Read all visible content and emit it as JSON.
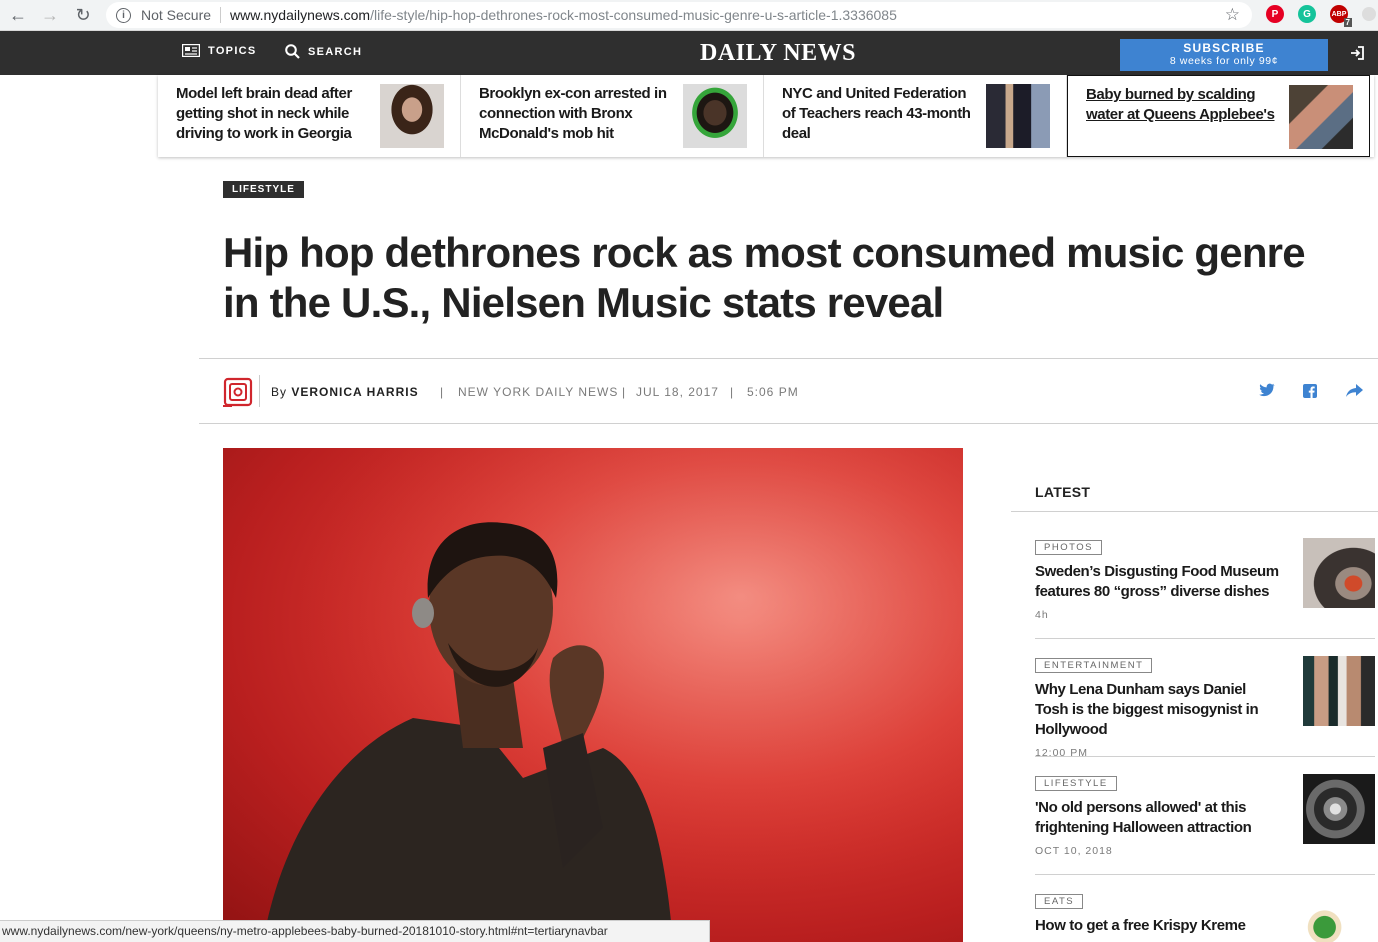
{
  "browser": {
    "security_label": "Not Secure",
    "url_host": "www.nydailynews.com",
    "url_path": "/life-style/hip-hop-dethrones-rock-most-consumed-music-genre-u-s-article-1.3336085",
    "status_url": "www.nydailynews.com/new-york/queens/ny-metro-applebees-baby-burned-20181010-story.html#nt=tertiarynavbar",
    "extensions": [
      {
        "name": "pinterest-icon",
        "color": "#e60023"
      },
      {
        "name": "grammarly-icon",
        "color": "#15c39a"
      },
      {
        "name": "adblock-icon",
        "color": "#c00000",
        "badge": "7"
      }
    ]
  },
  "header": {
    "topics_label": "TOPICS",
    "search_label": "SEARCH",
    "logo_text": "DAILY NEWS",
    "subscribe_label": "SUBSCRIBE",
    "subscribe_offer": "8 weeks for only 99¢"
  },
  "trending": [
    {
      "text": "Model left brain dead after getting shot in neck while driving to work in Georgia"
    },
    {
      "text": "Brooklyn ex-con arrested in connection with Bronx McDonald's mob hit"
    },
    {
      "text": "NYC and United Federation of Teachers reach 43-month deal"
    },
    {
      "text": "Baby burned by scalding water at Queens Applebee's"
    }
  ],
  "article": {
    "section": "LIFESTYLE",
    "headline": "Hip hop dethrones rock as most consumed music genre in the U.S., Nielsen Music stats reveal",
    "byline_prefix": "By",
    "author": "VERONICA HARRIS",
    "sep": "|",
    "publication": "NEW YORK DAILY NEWS",
    "date": "JUL 18, 2017",
    "time": "5:06 PM"
  },
  "sidebar": {
    "title": "LATEST",
    "items": [
      {
        "tag": "PHOTOS",
        "title": "Sweden’s Disgusting Food Museum features 80 “gross” diverse dishes",
        "time": "4h"
      },
      {
        "tag": "ENTERTAINMENT",
        "title": "Why Lena Dunham says Daniel Tosh is the biggest misogynist in Hollywood",
        "time": "12:00 PM"
      },
      {
        "tag": "LIFESTYLE",
        "title": "'No old persons allowed' at this frightening Halloween attraction",
        "time": "OCT 10, 2018"
      },
      {
        "tag": "EATS",
        "title": "How to get a free Krispy Kreme",
        "time": ""
      }
    ]
  }
}
